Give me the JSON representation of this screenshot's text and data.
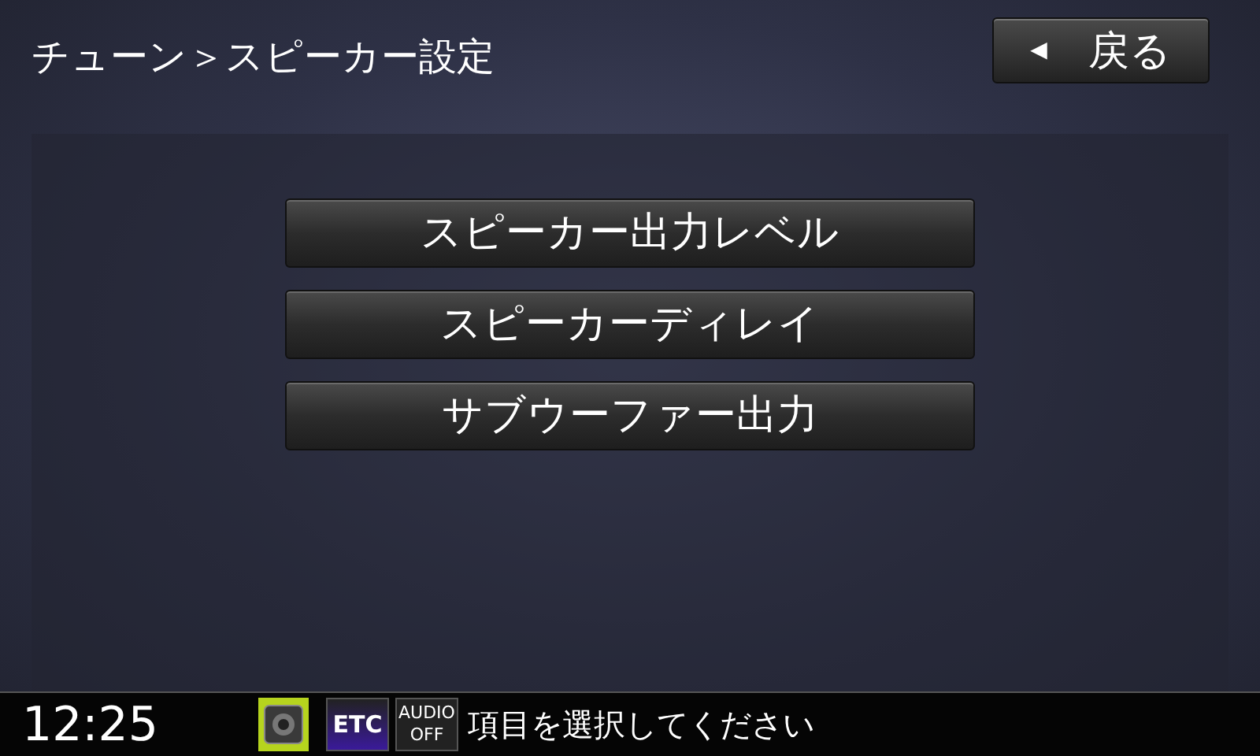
{
  "header": {
    "title": "チューン＞スピーカー設定",
    "back_button": {
      "arrow": "◀",
      "label": "戻る"
    }
  },
  "menu": [
    {
      "label": "スピーカー出力レベル"
    },
    {
      "label": "スピーカーディレイ"
    },
    {
      "label": "サブウーファー出力"
    }
  ],
  "status_bar": {
    "time": "12:25",
    "etc": "ETC",
    "audio": [
      "AUDIO",
      "OFF"
    ],
    "message": "項目を選択してください"
  }
}
